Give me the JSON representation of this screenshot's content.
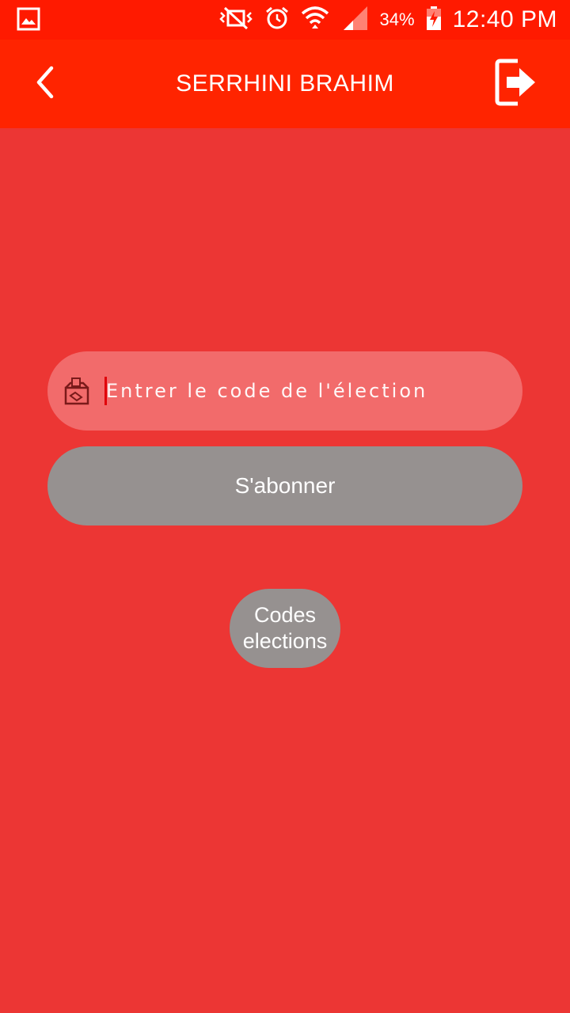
{
  "status_bar": {
    "battery_percent": "34%",
    "time": "12:40 PM",
    "icons": [
      "gallery-icon",
      "vibrate-mute-icon",
      "alarm-icon",
      "wifi-icon",
      "signal-icon",
      "battery-charging-icon"
    ]
  },
  "app_bar": {
    "title": "SERRHINI BRAHIM",
    "back_icon": "chevron-left-icon",
    "logout_icon": "logout-icon"
  },
  "form": {
    "code_placeholder": "Entrer le code de l'élection",
    "code_value": "",
    "field_icon": "ballot-box-icon",
    "subscribe_label": "S'abonner",
    "codes_label": "Codes\nelections"
  },
  "colors": {
    "status_bar": "#FF1A00",
    "app_bar": "#FF2400",
    "background": "#EC3634",
    "field": "#F26B6B",
    "button": "#969190"
  }
}
